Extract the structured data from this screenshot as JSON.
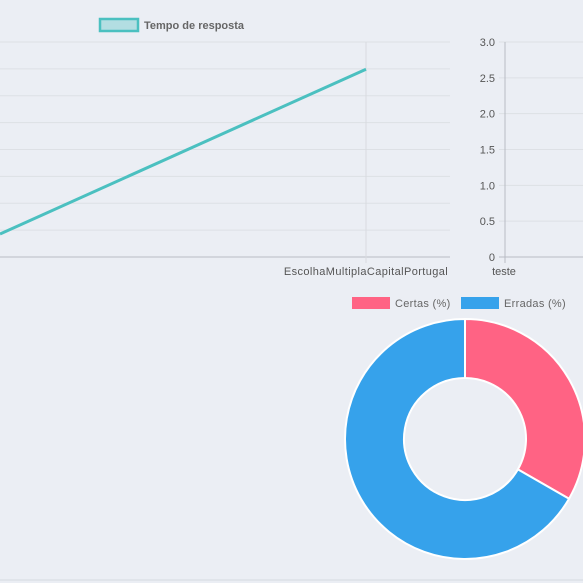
{
  "chart_data": [
    {
      "type": "line",
      "series": [
        {
          "name": "Tempo de resposta",
          "color": "#4bc0c0",
          "values": [
            null,
            2.62
          ]
        }
      ],
      "categories": [
        "",
        "EscolhaMultiplaCapitalPortugal"
      ],
      "legend_position": "top",
      "grid": true
    },
    {
      "type": "line",
      "categories": [
        "teste"
      ],
      "series": [],
      "y_ticks": [
        "3.0",
        "2.5",
        "2.0",
        "1.5",
        "1.0",
        "0.5",
        "0"
      ],
      "ylim": [
        0,
        3
      ],
      "grid": true
    },
    {
      "type": "pie",
      "style": "doughnut",
      "legend_position": "top",
      "labels": [
        "Certas (%)",
        "Erradas (%)"
      ],
      "values": [
        33.3,
        66.7
      ],
      "colors": [
        "#ff6384",
        "#36a2eb"
      ]
    }
  ]
}
